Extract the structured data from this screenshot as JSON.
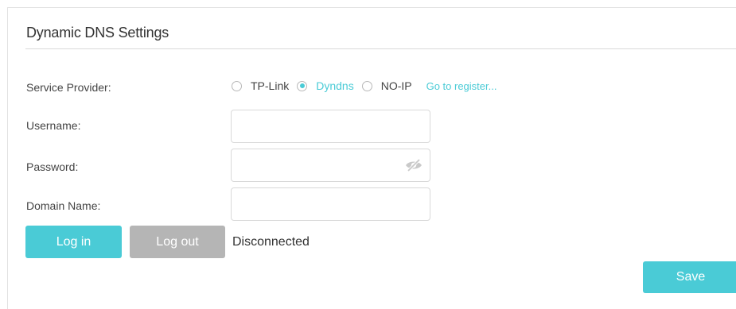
{
  "section": {
    "title": "Dynamic DNS Settings"
  },
  "service_provider": {
    "label": "Service Provider:",
    "options": [
      {
        "label": "TP-Link",
        "selected": false
      },
      {
        "label": "Dyndns",
        "selected": true
      },
      {
        "label": "NO-IP",
        "selected": false
      }
    ],
    "register_link": "Go to register..."
  },
  "username": {
    "label": "Username:",
    "value": "",
    "placeholder": ""
  },
  "password": {
    "label": "Password:",
    "value": "",
    "placeholder": "",
    "visibility_icon": "eye-slash-icon"
  },
  "domain_name": {
    "label": "Domain Name:",
    "value": "",
    "placeholder": ""
  },
  "actions": {
    "login_label": "Log in",
    "logout_label": "Log out",
    "status": "Disconnected",
    "save_label": "Save"
  },
  "colors": {
    "accent": "#4acbd6",
    "disabled_button": "#b5b5b5",
    "border": "#d9d9d9"
  }
}
